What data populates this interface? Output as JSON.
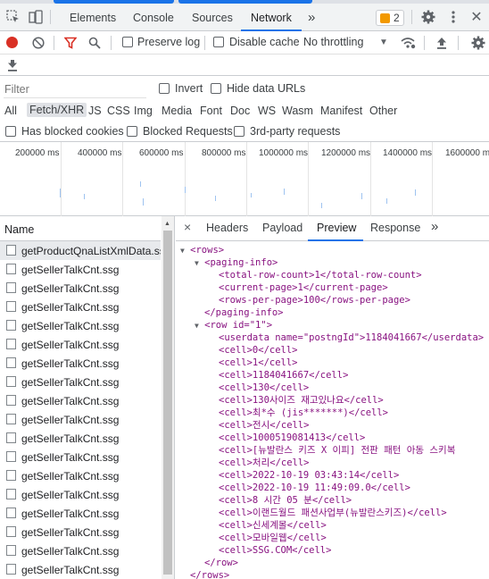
{
  "devtools": {
    "tabs": [
      "Elements",
      "Console",
      "Sources",
      "Network"
    ],
    "active_tab": "Network",
    "more_tabs": "»",
    "issues_badge": "2",
    "colors": {
      "accent": "#1a73e8",
      "record": "#d93025",
      "badge": "#f29900"
    }
  },
  "toolbar": {
    "preserve_log": "Preserve log",
    "disable_cache": "Disable cache",
    "throttling": "No throttling"
  },
  "filter": {
    "placeholder": "Filter",
    "invert": "Invert",
    "hide_data_urls": "Hide data URLs"
  },
  "types": [
    "All",
    "Fetch/XHR",
    "JS",
    "CSS",
    "Img",
    "Media",
    "Font",
    "Doc",
    "WS",
    "Wasm",
    "Manifest",
    "Other"
  ],
  "active_type": "Fetch/XHR",
  "block": {
    "blocked_cookies": "Has blocked cookies",
    "blocked_requests": "Blocked Requests",
    "third_party": "3rd-party requests"
  },
  "timeline": {
    "ticks": [
      "200000 ms",
      "400000 ms",
      "600000 ms",
      "800000 ms",
      "1000000 ms",
      "1200000 ms",
      "1400000 ms",
      "1600000 ms"
    ]
  },
  "requests": {
    "header": "Name",
    "items": [
      "getProductQnaListXmlData.ssg",
      "getSellerTalkCnt.ssg",
      "getSellerTalkCnt.ssg",
      "getSellerTalkCnt.ssg",
      "getSellerTalkCnt.ssg",
      "getSellerTalkCnt.ssg",
      "getSellerTalkCnt.ssg",
      "getSellerTalkCnt.ssg",
      "getSellerTalkCnt.ssg",
      "getSellerTalkCnt.ssg",
      "getSellerTalkCnt.ssg",
      "getSellerTalkCnt.ssg",
      "getSellerTalkCnt.ssg",
      "getSellerTalkCnt.ssg",
      "getSellerTalkCnt.ssg",
      "getSellerTalkCnt.ssg",
      "getSellerTalkCnt.ssg",
      "getSellerTalkCnt.ssg"
    ]
  },
  "detail": {
    "tabs": [
      "Headers",
      "Payload",
      "Preview",
      "Response"
    ],
    "active_tab": "Preview",
    "more": "»",
    "close": "×"
  },
  "xml": {
    "rows_open": "<rows>",
    "paging_open": "<paging-info>",
    "total_row_count": "<total-row-count>1</total-row-count>",
    "current_page": "<current-page>1</current-page>",
    "rows_per_page": "<rows-per-page>100</rows-per-page>",
    "paging_close": "</paging-info>",
    "row_open": "<row id=\"1\">",
    "cells": [
      "<userdata name=\"postngId\">1184041667</userdata>",
      "<cell>0</cell>",
      "<cell>1</cell>",
      "<cell>1184041667</cell>",
      "<cell>130</cell>",
      "<cell>130사이즈 재고있나요</cell>",
      "<cell>최*수 (jis*******)</cell>",
      "<cell>전시</cell>",
      "<cell>1000519081413</cell>",
      "<cell>[뉴발란스 키즈 X 이피] 전판 패턴 아동 스키복",
      "<cell>처리</cell>",
      "<cell>2022-10-19 03:43:14</cell>",
      "<cell>2022-10-19 11:49:09.0</cell>",
      "<cell>8 시간 05 분</cell>",
      "<cell>이랜드월드 패션사업부(뉴발란스키즈)</cell>",
      "<cell>신세계몰</cell>",
      "<cell>모바일웹</cell>",
      "<cell>SSG.COM</cell>"
    ],
    "row_close": "</row>",
    "rows_close": "</rows>"
  }
}
